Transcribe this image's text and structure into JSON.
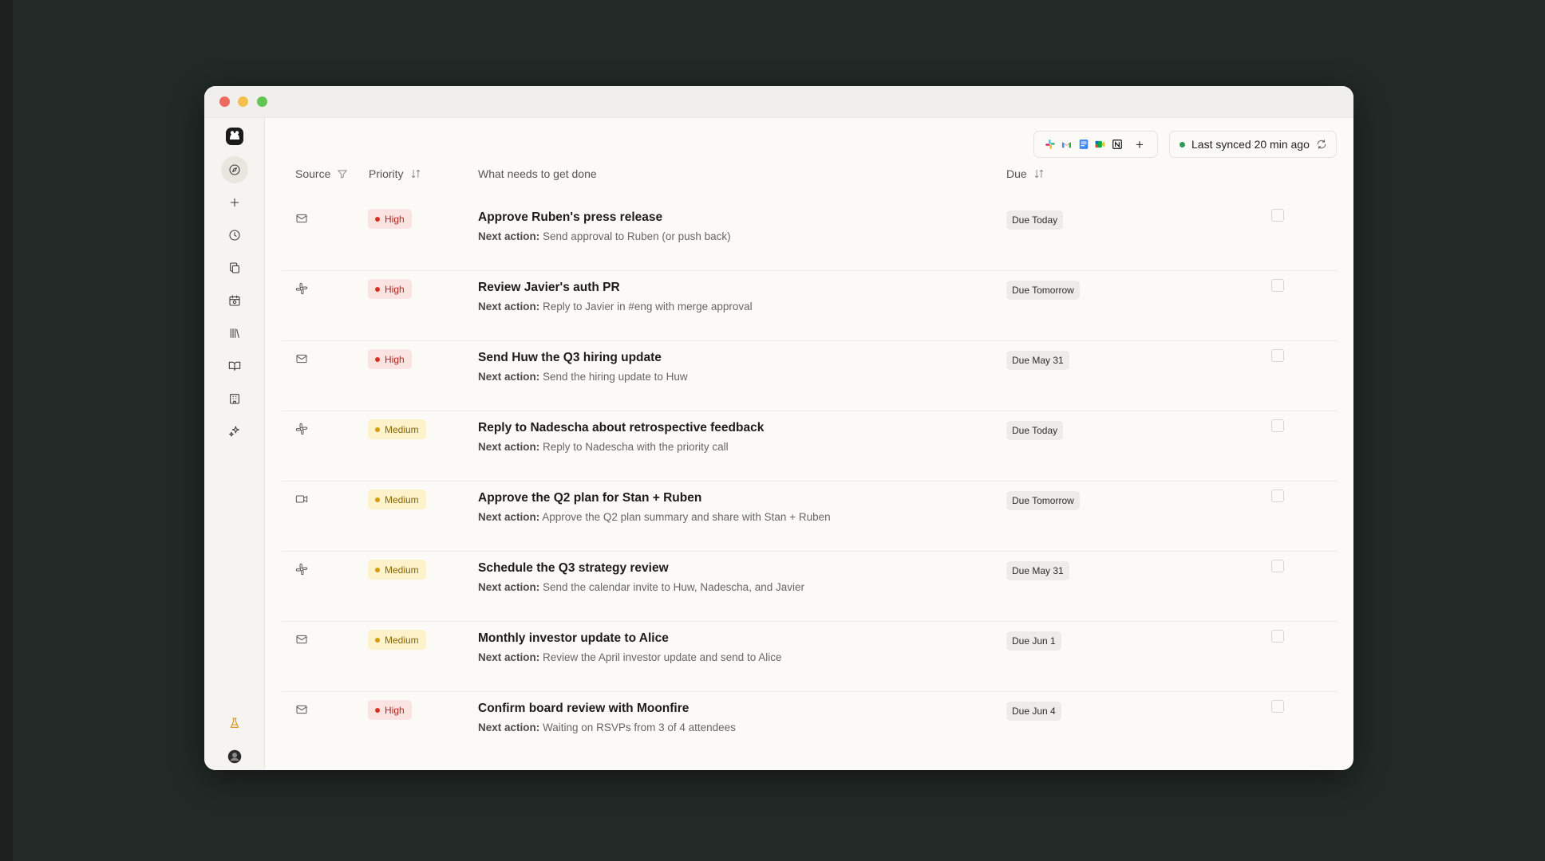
{
  "header": {
    "integrations": [
      "slack-icon",
      "gmail-icon",
      "google-docs-icon",
      "google-meet-icon",
      "notion-icon"
    ],
    "add_integration_label": "+",
    "sync_status": "Last synced 20 min ago",
    "sync_status_color": "#2f9a58"
  },
  "sidebar": {
    "items": [
      "logo-icon",
      "explore-icon",
      "plus-icon",
      "clock-icon",
      "copy-icon",
      "calendar-icon",
      "library-icon",
      "book-icon",
      "building-icon",
      "sparkles-icon"
    ],
    "bottom": [
      "lab-flask-icon",
      "user-avatar"
    ]
  },
  "table": {
    "columns": {
      "source": "Source",
      "priority": "Priority",
      "task": "What needs to get done",
      "due": "Due"
    },
    "next_action_prefix": "Next action:",
    "rows": [
      {
        "source": "email",
        "priority": "High",
        "title": "Approve Ruben's press release",
        "next": "Send approval to Ruben (or push back)",
        "due": "Due Today"
      },
      {
        "source": "slack",
        "priority": "High",
        "title": "Review Javier's auth PR",
        "next": "Reply to Javier in #eng with merge approval",
        "due": "Due Tomorrow"
      },
      {
        "source": "email",
        "priority": "High",
        "title": "Send Huw the Q3 hiring update",
        "next": "Send the hiring update to Huw",
        "due": "Due May 31"
      },
      {
        "source": "slack",
        "priority": "Medium",
        "title": "Reply to Nadescha about retrospective feedback",
        "next": "Reply to Nadescha with the priority call",
        "due": "Due Today"
      },
      {
        "source": "meeting",
        "priority": "Medium",
        "title": "Approve the Q2 plan for Stan + Ruben",
        "next": "Approve the Q2 plan summary and share with Stan + Ruben",
        "due": "Due Tomorrow"
      },
      {
        "source": "slack",
        "priority": "Medium",
        "title": "Schedule the Q3 strategy review",
        "next": "Send the calendar invite to Huw, Nadescha, and Javier",
        "due": "Due May 31"
      },
      {
        "source": "email",
        "priority": "Medium",
        "title": "Monthly investor update to Alice",
        "next": "Review the April investor update and send to Alice",
        "due": "Due Jun 1"
      },
      {
        "source": "email",
        "priority": "High",
        "title": "Confirm board review with Moonfire",
        "next": "Waiting on RSVPs from 3 of 4 attendees",
        "due": "Due Jun 4"
      }
    ]
  }
}
